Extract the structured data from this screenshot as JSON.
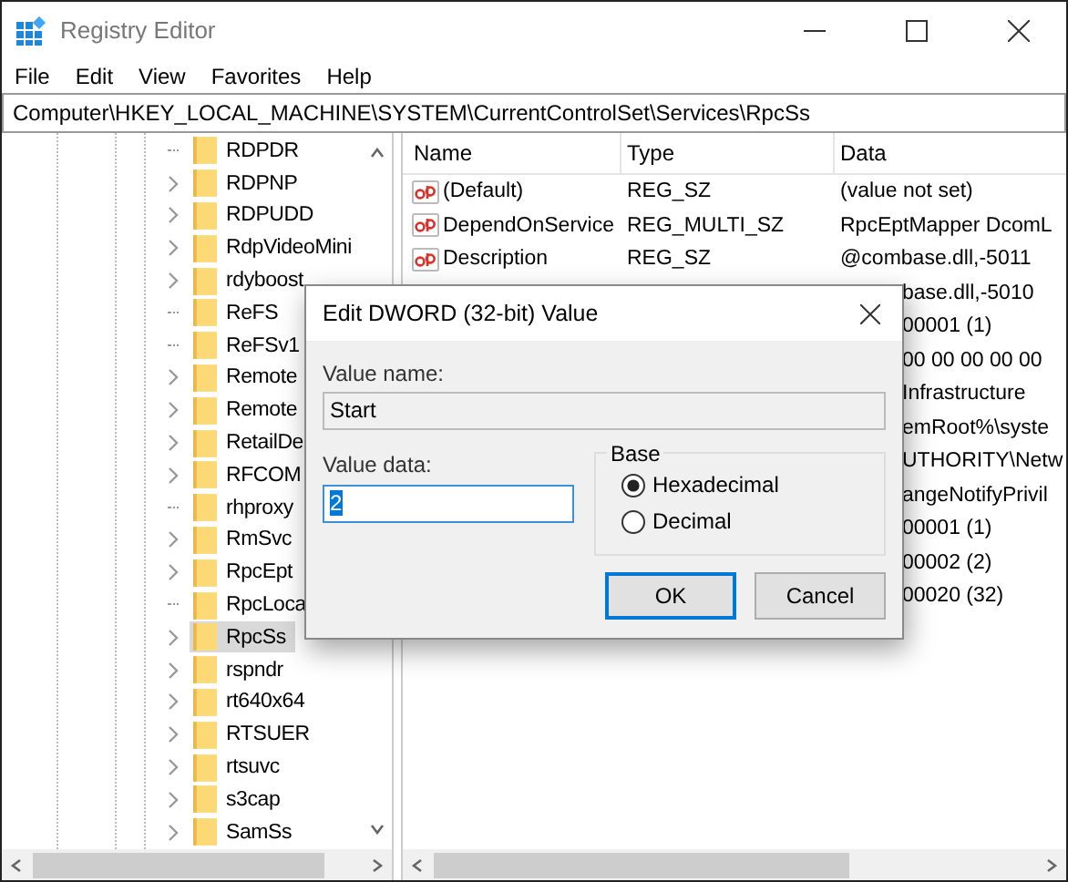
{
  "window": {
    "title": "Registry Editor"
  },
  "menu": [
    "File",
    "Edit",
    "View",
    "Favorites",
    "Help"
  ],
  "address_bar": "Computer\\HKEY_LOCAL_MACHINE\\SYSTEM\\CurrentControlSet\\Services\\RpcSs",
  "tree": {
    "items": [
      {
        "label": "RDPDR",
        "has_children": false,
        "selected": false
      },
      {
        "label": "RDPNP",
        "has_children": true,
        "selected": false
      },
      {
        "label": "RDPUDD",
        "has_children": true,
        "selected": false
      },
      {
        "label": "RdpVideoMini",
        "has_children": true,
        "selected": false
      },
      {
        "label": "rdyboost",
        "has_children": true,
        "selected": false
      },
      {
        "label": "ReFS",
        "has_children": false,
        "selected": false
      },
      {
        "label": "ReFSv1",
        "has_children": false,
        "selected": false
      },
      {
        "label": "Remote",
        "has_children": true,
        "selected": false
      },
      {
        "label": "Remote",
        "has_children": true,
        "selected": false
      },
      {
        "label": "RetailDe",
        "has_children": true,
        "selected": false
      },
      {
        "label": "RFCOM",
        "has_children": true,
        "selected": false
      },
      {
        "label": "rhproxy",
        "has_children": false,
        "selected": false
      },
      {
        "label": "RmSvc",
        "has_children": true,
        "selected": false
      },
      {
        "label": "RpcEpt",
        "has_children": true,
        "selected": false
      },
      {
        "label": "RpcLoca",
        "has_children": false,
        "selected": false
      },
      {
        "label": "RpcSs",
        "has_children": true,
        "selected": true
      },
      {
        "label": "rspndr",
        "has_children": true,
        "selected": false
      },
      {
        "label": "rt640x64",
        "has_children": true,
        "selected": false
      },
      {
        "label": "RTSUER",
        "has_children": true,
        "selected": false
      },
      {
        "label": "rtsuvc",
        "has_children": true,
        "selected": false
      },
      {
        "label": "s3cap",
        "has_children": true,
        "selected": false
      },
      {
        "label": "SamSs",
        "has_children": true,
        "selected": false
      }
    ]
  },
  "values": {
    "columns": [
      "Name",
      "Type",
      "Data"
    ],
    "rows": [
      {
        "name": "(Default)",
        "type": "REG_SZ",
        "data": "(value not set)"
      },
      {
        "name": "DependOnService",
        "type": "REG_MULTI_SZ",
        "data": "RpcEptMapper DcomL"
      },
      {
        "name": "Description",
        "type": "REG_SZ",
        "data": "@combase.dll,-5011"
      },
      {
        "data": "base.dll,-5010"
      },
      {
        "data": "00001 (1)"
      },
      {
        "data": "00 00 00 00 00"
      },
      {
        "data": "Infrastructure"
      },
      {
        "data": "emRoot%\\syste"
      },
      {
        "data": "UTHORITY\\Netw"
      },
      {
        "data": "angeNotifyPrivil"
      },
      {
        "data": "00001 (1)"
      },
      {
        "data": "00002 (2)"
      },
      {
        "data": "00020 (32)"
      }
    ]
  },
  "dialog": {
    "title": "Edit DWORD (32-bit) Value",
    "value_name_label": "Value name:",
    "value_name": "Start",
    "value_data_label": "Value data:",
    "value_data": "2",
    "value_data_selected": true,
    "base": {
      "label": "Base",
      "options": [
        {
          "label": "Hexadecimal",
          "selected": true
        },
        {
          "label": "Decimal",
          "selected": false
        }
      ]
    },
    "buttons": [
      {
        "label": "OK",
        "default": true
      },
      {
        "label": "Cancel",
        "default": false
      }
    ]
  }
}
